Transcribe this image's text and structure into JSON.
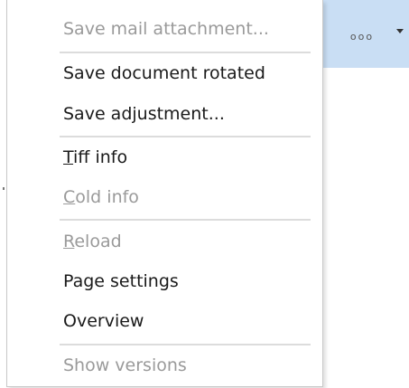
{
  "toolbar": {
    "more_label": "ooo",
    "accent_color": "#c9def4"
  },
  "menu": {
    "items": [
      {
        "pre": "",
        "mnemonic": "",
        "rest": "Save mail attachment...",
        "enabled": false
      },
      {
        "pre": "",
        "mnemonic": "",
        "rest": "Save document rotated",
        "enabled": true
      },
      {
        "pre": "",
        "mnemonic": "",
        "rest": "Save adjustment...",
        "enabled": true
      },
      {
        "pre": "",
        "mnemonic": "T",
        "rest": "iff info",
        "enabled": true
      },
      {
        "pre": "",
        "mnemonic": "C",
        "rest": "old info",
        "enabled": false
      },
      {
        "pre": "",
        "mnemonic": "R",
        "rest": "eload",
        "enabled": false
      },
      {
        "pre": "",
        "mnemonic": "",
        "rest": "Page settings",
        "enabled": true
      },
      {
        "pre": "",
        "mnemonic": "",
        "rest": "Overview",
        "enabled": true
      },
      {
        "pre": "",
        "mnemonic": "",
        "rest": "Show versions",
        "enabled": false
      }
    ]
  }
}
